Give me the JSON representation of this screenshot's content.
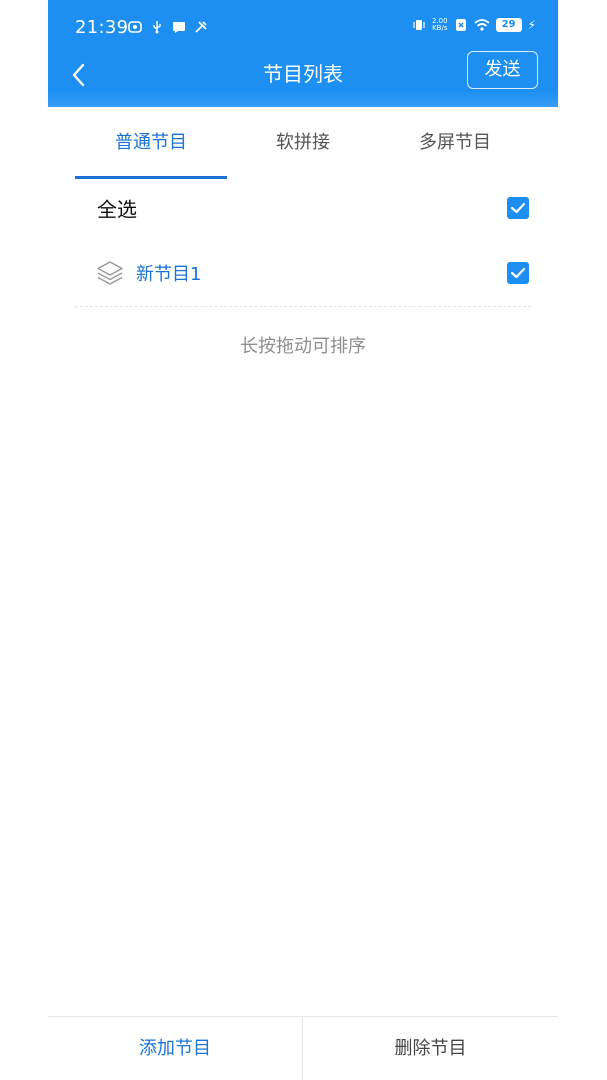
{
  "status_bar": {
    "time": "21:39",
    "net_speed_value": "2.00",
    "net_speed_unit": "KB/s",
    "battery": "29"
  },
  "header": {
    "title": "节目列表",
    "send_label": "发送"
  },
  "tabs": [
    {
      "label": "普通节目",
      "active": true
    },
    {
      "label": "软拼接",
      "active": false
    },
    {
      "label": "多屏节目",
      "active": false
    }
  ],
  "list": {
    "select_all_label": "全选",
    "select_all_checked": true,
    "items": [
      {
        "name": "新节目1",
        "checked": true
      }
    ]
  },
  "hint": "长按拖动可排序",
  "bottom_bar": {
    "add_label": "添加节目",
    "delete_label": "删除节目"
  },
  "colors": {
    "primary": "#1d8ff3",
    "accent_text": "#1a73d9"
  }
}
